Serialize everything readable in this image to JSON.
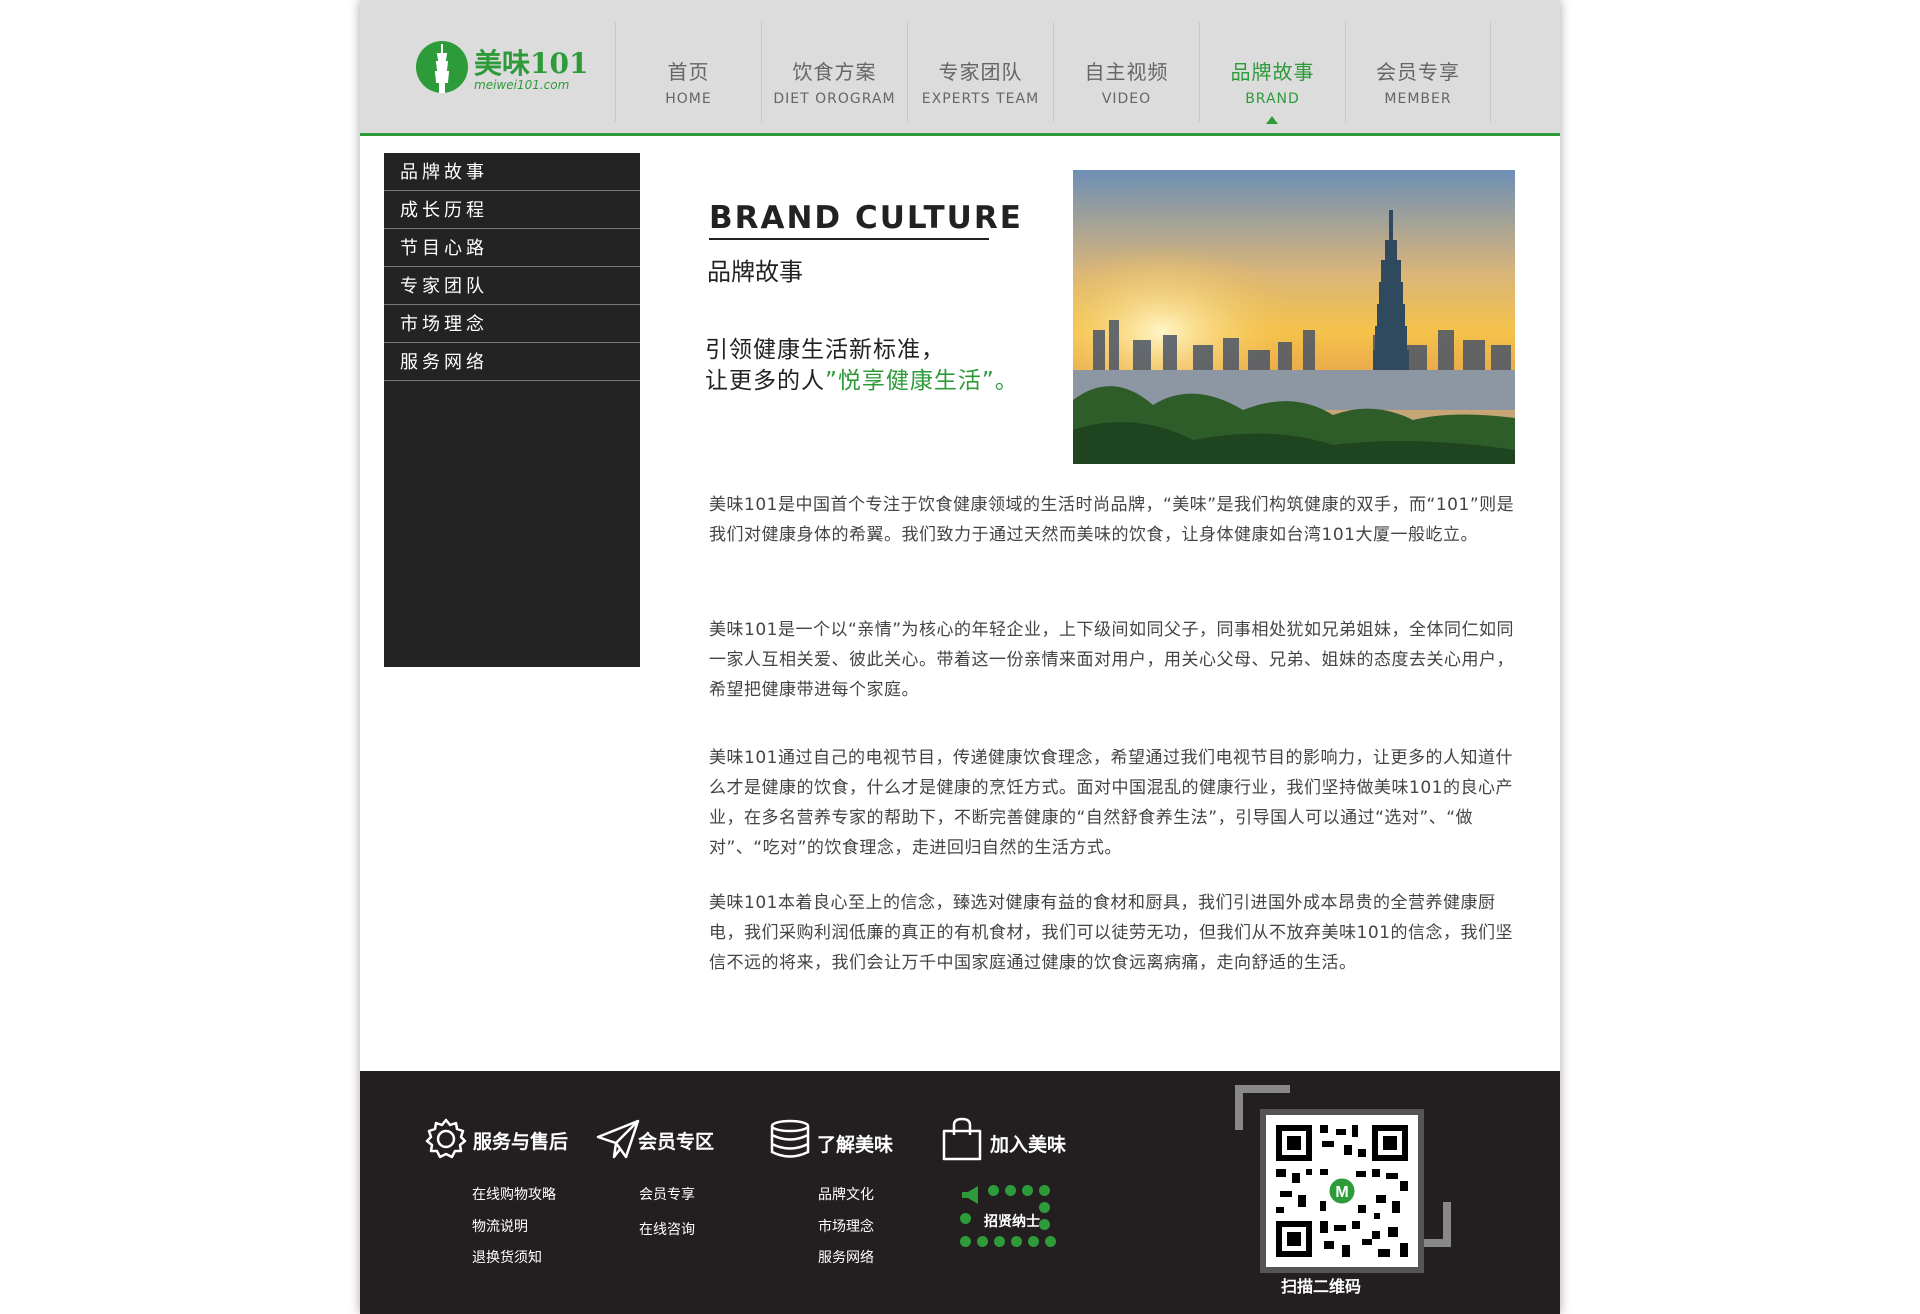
{
  "header": {
    "logo_text": "美味101",
    "logo_sub": "meiwei101.com",
    "nav": [
      {
        "cn": "首页",
        "en": "HOME"
      },
      {
        "cn": "饮食方案",
        "en": "DIET OROGRAM"
      },
      {
        "cn": "专家团队",
        "en": "EXPERTS TEAM"
      },
      {
        "cn": "自主视频",
        "en": "VIDEO"
      },
      {
        "cn": "品牌故事",
        "en": "BRAND"
      },
      {
        "cn": "会员专享",
        "en": "MEMBER"
      }
    ],
    "active_index": 4
  },
  "sidebar": {
    "items": [
      "品牌故事",
      "成长历程",
      "节目心路",
      "专家团队",
      "市场理念",
      "服务网络"
    ]
  },
  "main": {
    "title_en": "BRAND CULTURE",
    "title_cn": "品牌故事",
    "slogan_line1": "引领健康生活新标准，",
    "slogan_line2_prefix": "让更多的人",
    "slogan_line2_highlight": "”悦享健康生活”",
    "slogan_line2_suffix": "。",
    "paragraphs": [
      "美味101是中国首个专注于饮食健康领域的生活时尚品牌，“美味”是我们构筑健康的双手，而“101”则是我们对健康身体的希翼。我们致力于通过天然而美味的饮食，让身体健康如台湾101大厦一般屹立。",
      "美味101是一个以“亲情”为核心的年轻企业，上下级间如同父子，同事相处犹如兄弟姐妹，全体同仁如同一家人互相关爱、彼此关心。带着这一份亲情来面对用户，用关心父母、兄弟、姐妹的态度去关心用户，希望把健康带进每个家庭。",
      "美味101通过自己的电视节目，传递健康饮食理念，希望通过我们电视节目的影响力，让更多的人知道什么才是健康的饮食，什么才是健康的烹饪方式。面对中国混乱的健康行业，我们坚持做美味101的良心产业，在多名营养专家的帮助下，不断完善健康的“自然舒食养生法”，引导国人可以通过“选对”、“做对”、“吃对”的饮食理念，走进回归自然的生活方式。",
      "美味101本着良心至上的信念，臻选对健康有益的食材和厨具，我们引进国外成本昂贵的全营养健康厨电，我们采购利润低廉的真正的有机食材，我们可以徒劳无功，但我们从不放弃美味101的信念，我们坚信不远的将来，我们会让万千中国家庭通过健康的饮食远离病痛，走向舒适的生活。"
    ]
  },
  "footer": {
    "service": {
      "title": "服务与售后",
      "links": [
        "在线购物攻略",
        "物流说明",
        "退换货须知"
      ]
    },
    "member": {
      "title": "会员专区",
      "links": [
        "会员专享",
        "在线咨询"
      ]
    },
    "about": {
      "title": "了解美味",
      "links": [
        "品牌文化",
        "市场理念",
        "服务网络"
      ]
    },
    "join": {
      "title": "加入美味",
      "links": [
        "招贤纳士"
      ]
    },
    "qr_caption": "扫描二维码",
    "accent": "#2e9b3a"
  }
}
